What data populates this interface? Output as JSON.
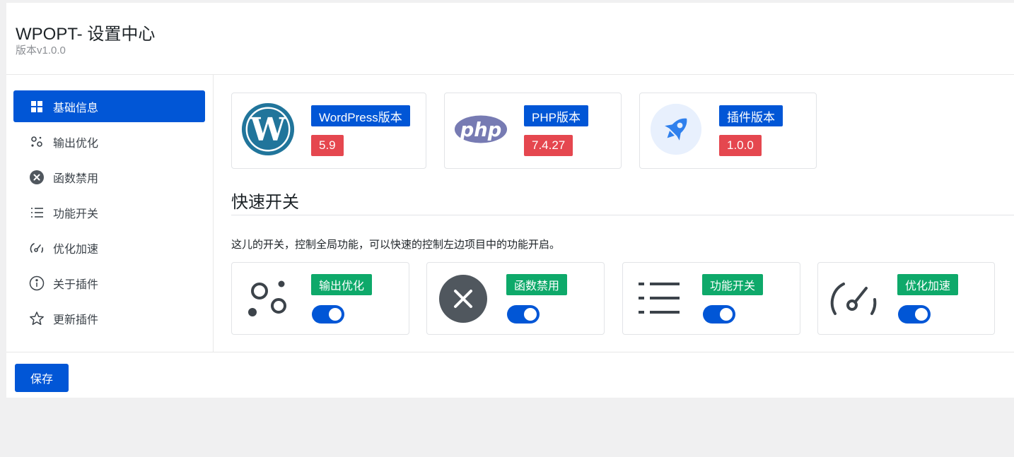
{
  "header": {
    "title": "WPOPT- 设置中心",
    "version": "版本v1.0.0"
  },
  "sidebar": {
    "items": [
      {
        "label": "基础信息",
        "icon": "grid-icon",
        "active": true
      },
      {
        "label": "输出优化",
        "icon": "circles-icon",
        "active": false
      },
      {
        "label": "函数禁用",
        "icon": "close-circle-icon",
        "active": false
      },
      {
        "label": "功能开关",
        "icon": "list-icon",
        "active": false
      },
      {
        "label": "优化加速",
        "icon": "speedometer-icon",
        "active": false
      },
      {
        "label": "关于插件",
        "icon": "info-icon",
        "active": false
      },
      {
        "label": "更新插件",
        "icon": "star-icon",
        "active": false
      }
    ]
  },
  "info_cards": [
    {
      "label": "WordPress版本",
      "value": "5.9",
      "icon": "wordpress-logo-icon"
    },
    {
      "label": "PHP版本",
      "value": "7.4.27",
      "icon": "php-logo-icon"
    },
    {
      "label": "插件版本",
      "value": "1.0.0",
      "icon": "rocket-icon"
    }
  ],
  "quick_switch": {
    "title": "快速开关",
    "description": "这儿的开关，控制全局功能，可以快速的控制左边项目中的功能开启。",
    "cards": [
      {
        "label": "输出优化",
        "icon": "circles-icon",
        "enabled": true
      },
      {
        "label": "函数禁用",
        "icon": "close-circle-icon",
        "enabled": true
      },
      {
        "label": "功能开关",
        "icon": "list-icon",
        "enabled": true
      },
      {
        "label": "优化加速",
        "icon": "speedometer-icon",
        "enabled": true
      }
    ]
  },
  "footer": {
    "save_label": "保存"
  },
  "colors": {
    "primary": "#0156d6",
    "danger": "#e5474f",
    "success": "#0ea96a",
    "wordpress": "#21759b",
    "php": "#777bb3"
  }
}
